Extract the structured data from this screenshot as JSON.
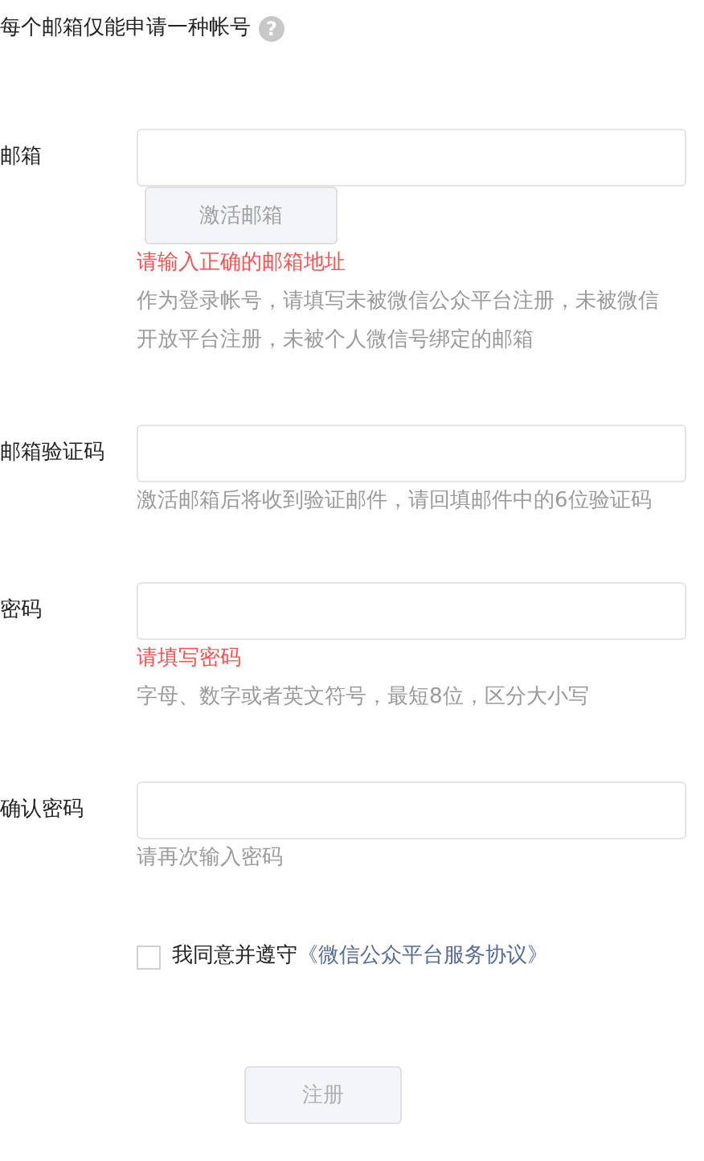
{
  "notice": {
    "text": "每个邮箱仅能申请一种帐号",
    "help_icon": "?"
  },
  "fields": [
    {
      "label": "邮箱",
      "button": "激活邮箱",
      "error": "请输入正确的邮箱地址",
      "hint": "作为登录帐号，请填写未被微信公众平台注册，未被微信开放平台注册，未被个人微信号绑定的邮箱"
    },
    {
      "label": "邮箱验证码",
      "hint": "激活邮箱后将收到验证邮件，请回填邮件中的6位验证码"
    },
    {
      "label": "密码",
      "error": "请填写密码",
      "hint": "字母、数字或者英文符号，最短8位，区分大小写"
    },
    {
      "label": "确认密码",
      "hint": "请再次输入密码"
    }
  ],
  "agreement": {
    "checked": false,
    "text": "我同意并遵守",
    "link": "《微信公众平台服务协议》"
  },
  "submit": {
    "label": "注册",
    "disabled": true
  }
}
